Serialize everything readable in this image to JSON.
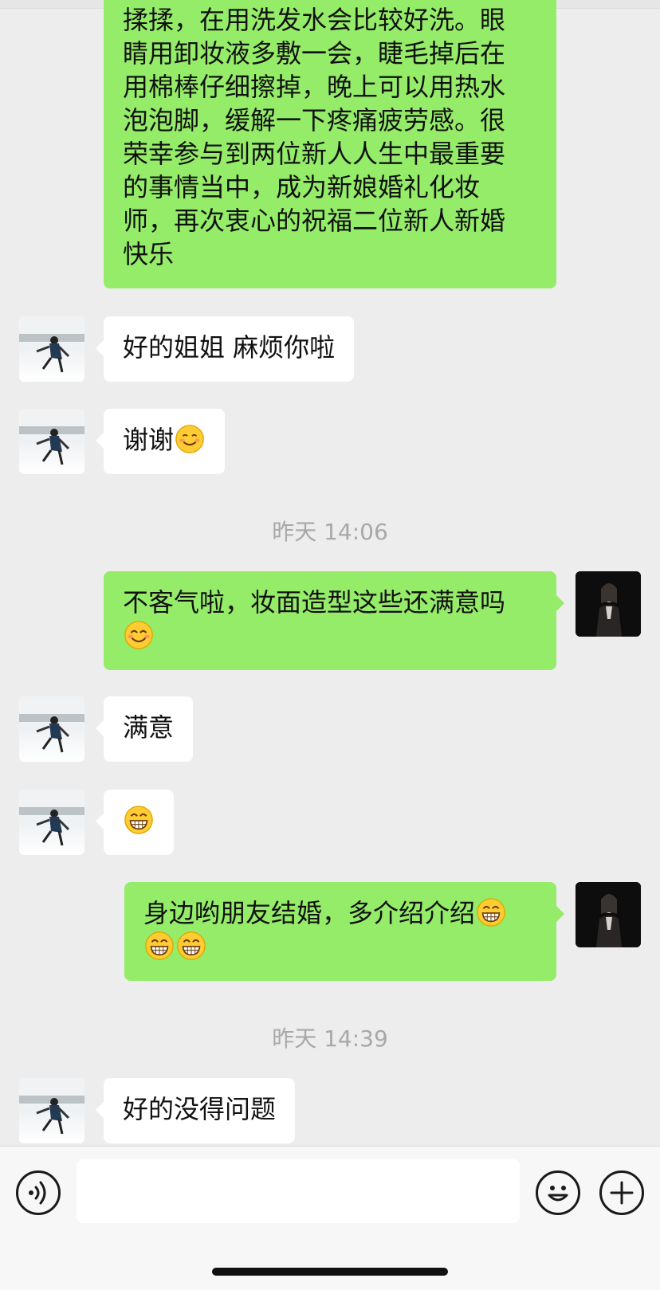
{
  "chat": {
    "messages": [
      {
        "text": "揉揉，在用洗发水会比较好洗。眼\n睛用卸妆液多敷一会，睫毛掉后在\n用棉棒仔细擦掉，晚上可以用热水\n泡泡脚，缓解一下疼痛疲劳感。很\n荣幸参与到两位新人人生中最重要\n的事情当中，成为新娘婚礼化妆\n师，再次衷心的祝福二位新人新婚\n快乐"
      },
      {
        "text": "好的姐姐 麻烦你啦"
      },
      {
        "text": "谢谢"
      },
      {
        "text": "不客气啦，妆面造型这些还满意吗"
      },
      {
        "text": "满意"
      },
      {
        "text": ""
      },
      {
        "text": "身边哟朋友结婚，多介绍介绍"
      },
      {
        "text": "好的没得问题"
      }
    ],
    "timestamps": [
      "昨天 14:06",
      "昨天 14:39"
    ]
  },
  "icons": {
    "smile": "smiling-face-icon",
    "blush": "smiling-face-with-smiling-eyes-icon",
    "grin": "grinning-face-icon",
    "voice": "voice-icon",
    "emoji_button": "emoji-icon",
    "plus": "plus-icon"
  },
  "colors": {
    "outgoing_bubble": "#95ec69",
    "incoming_bubble": "#ffffff",
    "background": "#ededed"
  },
  "input": {
    "value": ""
  }
}
